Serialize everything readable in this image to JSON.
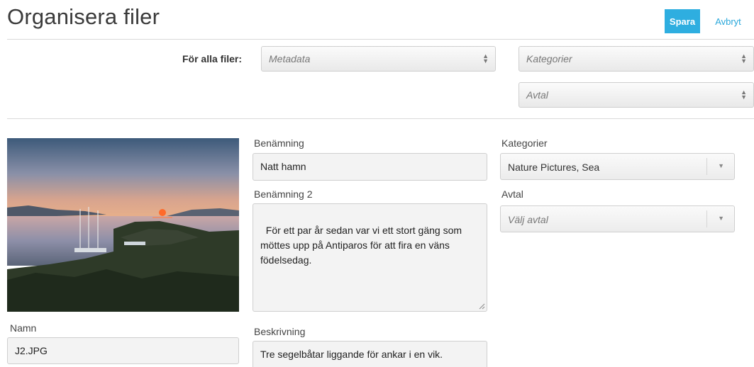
{
  "header": {
    "title": "Organisera filer",
    "save_label": "Spara",
    "cancel_label": "Avbryt"
  },
  "bulk": {
    "label": "För alla filer:",
    "metadata_placeholder": "Metadata",
    "categories_placeholder": "Kategorier",
    "agreement_placeholder": "Avtal"
  },
  "file": {
    "name_label": "Namn",
    "name_value": "J2.JPG",
    "title_label": "Benämning",
    "title_value": "Natt hamn",
    "title2_label": "Benämning 2",
    "title2_value": "För ett par år sedan var vi ett stort gäng som möttes upp på Antiparos för att fira en väns födelsedag.",
    "description_label": "Beskrivning",
    "description_value": "Tre segelbåtar liggande för ankar i en vik.",
    "categories_label": "Kategorier",
    "categories_value": "Nature Pictures, Sea",
    "agreement_label": "Avtal",
    "agreement_placeholder": "Välj avtal"
  },
  "icons": {
    "select_arrows": "up-down-arrows-icon",
    "dropdown_caret": "caret-down-icon",
    "resize": "resize-handle-icon"
  },
  "colors": {
    "accent": "#2eaee0",
    "link": "#2aa8db",
    "divider": "#d9d9d9"
  }
}
